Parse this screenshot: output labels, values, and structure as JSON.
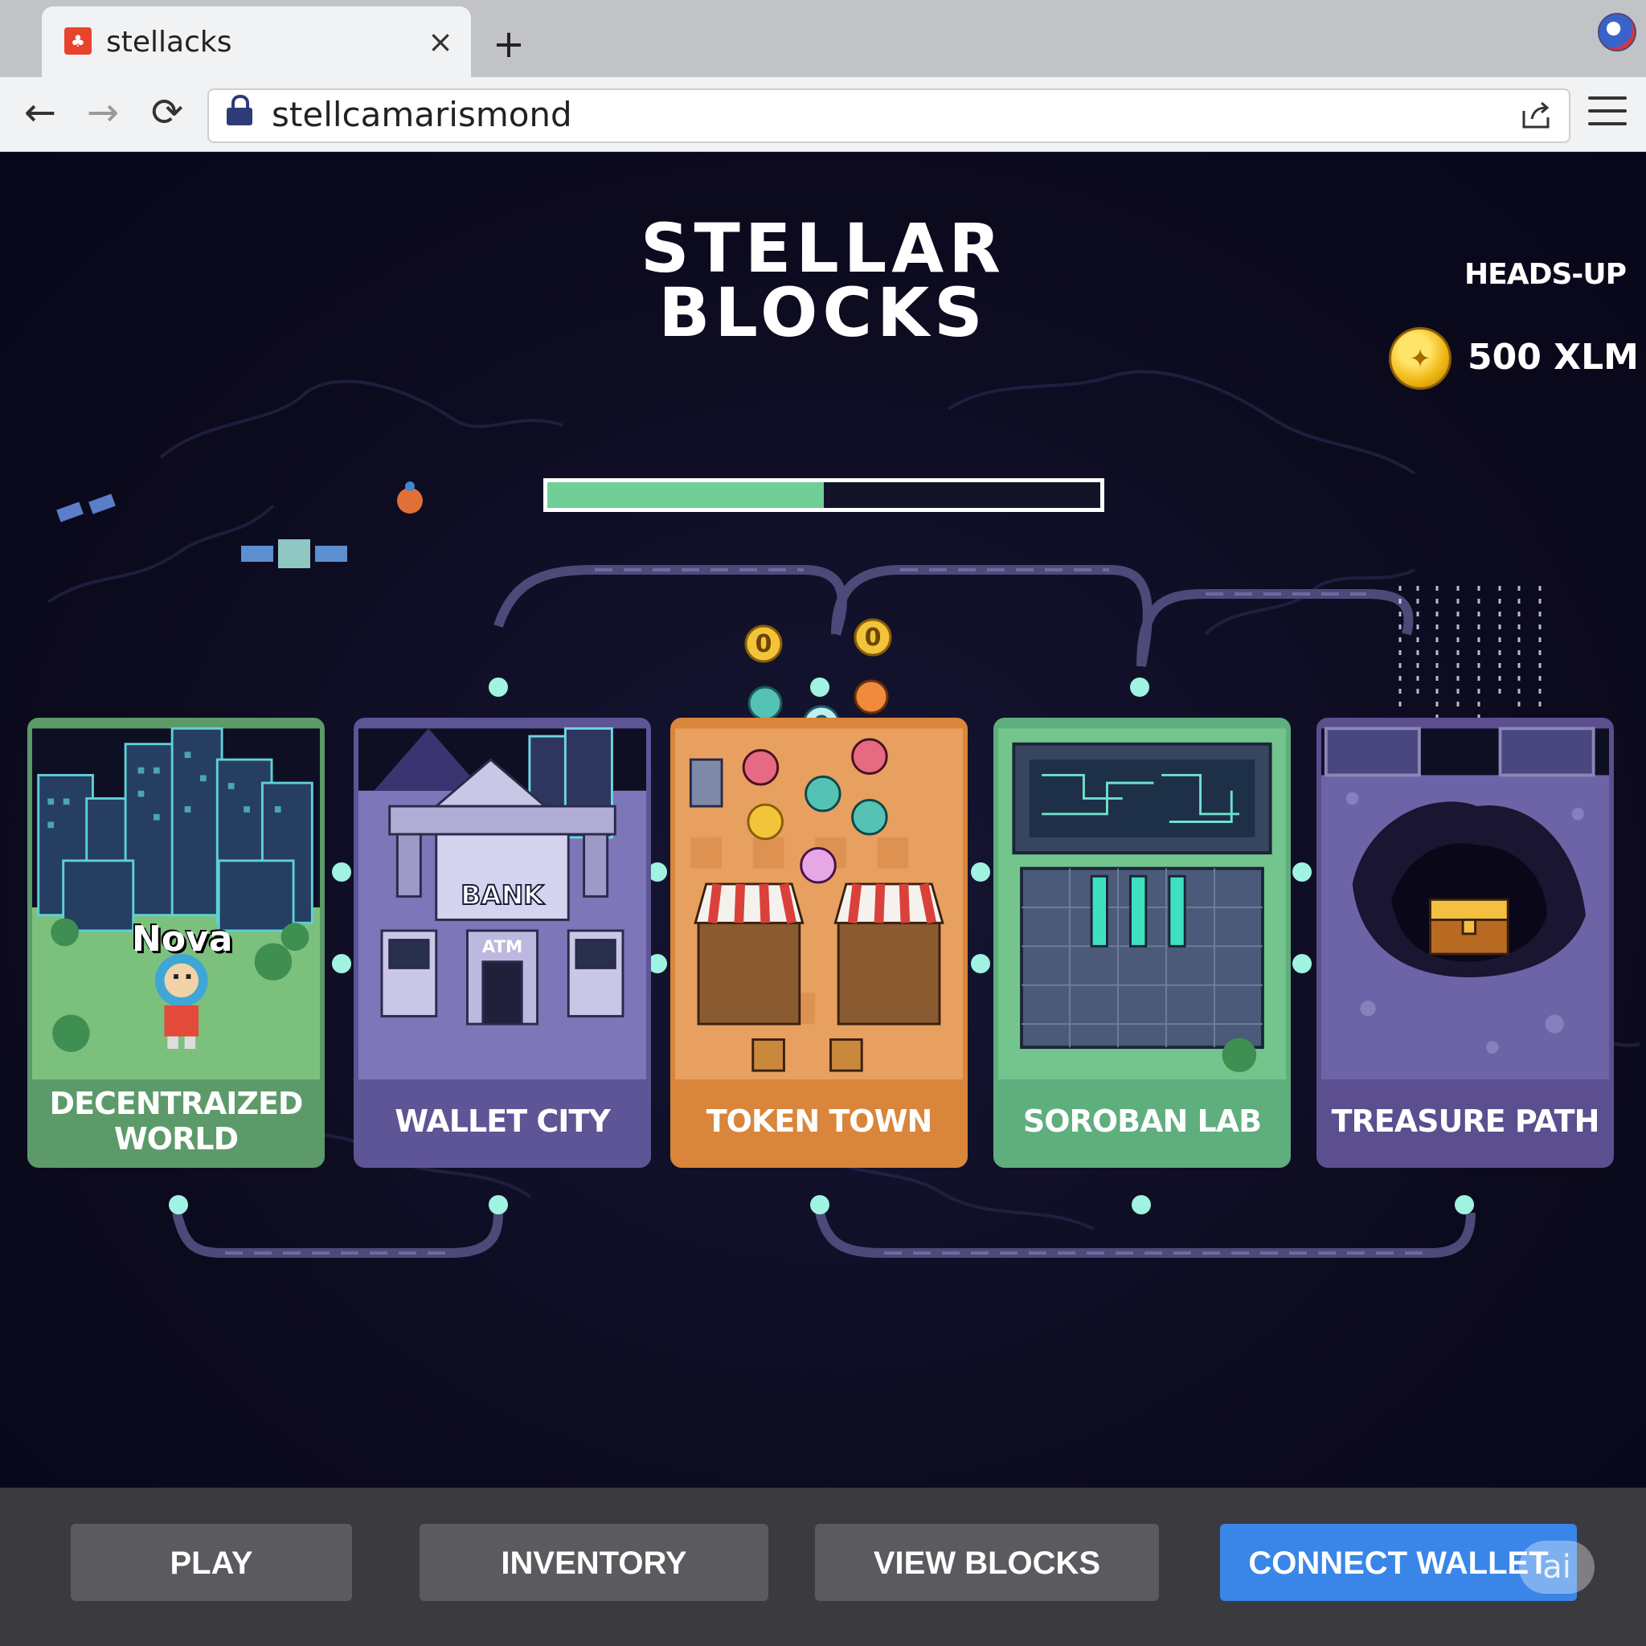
{
  "browser": {
    "tab_title": "stellacks",
    "url": "stellcamarismond",
    "tab_close_glyph": "×",
    "new_tab_glyph": "+",
    "back_glyph": "←",
    "forward_glyph": "→",
    "reload_glyph": "⟳",
    "icons": [
      "favicon-icon",
      "close-icon",
      "plus-icon",
      "back-icon",
      "forward-icon",
      "reload-icon",
      "lock-icon",
      "share-icon",
      "menu-icon",
      "profile-icon"
    ]
  },
  "game": {
    "title_line1": "STELLAR",
    "title_line2": "BLOCKS",
    "hud_label": "HEADS-UP",
    "balance": "500 XLM",
    "progress": 0.5,
    "character_name": "Nova",
    "zones": [
      {
        "label": "DECENTRAIZED\nWORLD",
        "color": "#5d9a6a"
      },
      {
        "label": "WALLET CITY",
        "color": "#5e5596"
      },
      {
        "label": "TOKEN TOWN",
        "color": "#d9853b"
      },
      {
        "label": "SOROBAN LAB",
        "color": "#5fae7e"
      },
      {
        "label": "TREASURE PATH",
        "color": "#5b4f8f"
      }
    ],
    "bank_sign": "BANK",
    "atm_sign": "ATM"
  },
  "actions": {
    "play": "PLAY",
    "inventory": "INVENTORY",
    "view_blocks": "VIEW BLOCKS",
    "connect_wallet": "CONNECT WALLET",
    "ai_badge": "ai"
  },
  "colors": {
    "accent": "#3a86e8",
    "progress": "#6fcf97",
    "background": "#0c0a1c"
  }
}
